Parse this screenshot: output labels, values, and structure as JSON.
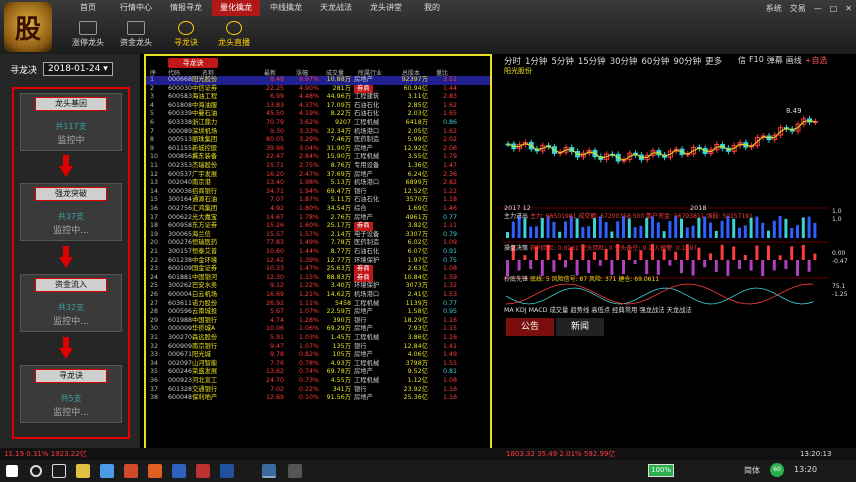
{
  "nav": {
    "tabs": [
      "首页",
      "行情中心",
      "情报寻龙",
      "量化擒龙",
      "中线擒龙",
      "天龙战法",
      "龙头讲堂",
      "我的"
    ],
    "active_index": 3,
    "toolbar": [
      "涨停龙头",
      "资金龙头",
      "寻龙诀",
      "龙头直播"
    ],
    "window": [
      "系统",
      "交易"
    ]
  },
  "logo": {
    "text": "股"
  },
  "left": {
    "title": "寻龙决",
    "date": "2018-01-24",
    "cards": [
      {
        "title": "龙头基因",
        "count": "共117支",
        "monitor": "监控中"
      },
      {
        "title": "强龙突破",
        "count": "共37支",
        "monitor": "监控中..."
      },
      {
        "title": "资金流入",
        "count": "共32支",
        "monitor": "监控中..."
      },
      {
        "title": "寻龙诀",
        "count": "共5支",
        "monitor": "监控中..."
      }
    ]
  },
  "table": {
    "tab": "寻龙诀",
    "headers": [
      "序",
      "代码",
      "名称",
      "最新",
      "涨幅",
      "成交量",
      "所属行业",
      "总股本",
      "量比"
    ],
    "rows": [
      [
        "1",
        "000668",
        "阳光股份",
        "8.49",
        "9.97%",
        "10.88万",
        "房地产",
        "92397万",
        "3.51"
      ],
      [
        "2",
        "600030",
        "中信证券",
        "22.25",
        "4.90%",
        "281万",
        "券商",
        "60.94亿",
        "1.44"
      ],
      [
        "3",
        "600583",
        "海油工程",
        "6.99",
        "4.48%",
        "44.96万",
        "工程建筑",
        "3.11亿",
        "2.83"
      ],
      [
        "4",
        "601808",
        "中海油服",
        "13.83",
        "4.37%",
        "17.09万",
        "石油石化",
        "2.85亿",
        "1.62"
      ],
      [
        "5",
        "600339",
        "中曼石油",
        "45.50",
        "4.19%",
        "8.22万",
        "石油石化",
        "2.03亿",
        "1.65"
      ],
      [
        "6",
        "603338",
        "浙江鼎力",
        "70.79",
        "3.62%",
        "9207",
        "工程机械",
        "6418万",
        "0.86"
      ],
      [
        "7",
        "000089",
        "深圳机场",
        "9.30",
        "3.33%",
        "32.34万",
        "机场港口",
        "2.05亿",
        "1.62"
      ],
      [
        "8",
        "000513",
        "丽珠集团",
        "80.05",
        "3.29%",
        "7.46万",
        "医药制造",
        "5.99亿",
        "2.02"
      ],
      [
        "9",
        "601155",
        "新城控股",
        "39.96",
        "3.04%",
        "31.90万",
        "房地产",
        "12.92亿",
        "2.06"
      ],
      [
        "10",
        "000856",
        "冀东装备",
        "22.47",
        "2.84%",
        "15.90万",
        "工程机械",
        "3.55亿",
        "1.79"
      ],
      [
        "11",
        "002353",
        "杰瑞股份",
        "15.71",
        "2.75%",
        "8.76万",
        "专用设备",
        "1.36亿",
        "1.47"
      ],
      [
        "12",
        "600537",
        "广宇发展",
        "16.20",
        "2.47%",
        "37.69万",
        "房地产",
        "6.24亿",
        "2.36"
      ],
      [
        "13",
        "002040",
        "南京港",
        "13.40",
        "1.98%",
        "5.13万",
        "机场港口",
        "6899万",
        "2.82"
      ],
      [
        "14",
        "000036",
        "招商银行",
        "34.71",
        "1.94%",
        "69.47万",
        "银行",
        "12.52亿",
        "1.22"
      ],
      [
        "15",
        "300164",
        "通源石油",
        "7.07",
        "1.87%",
        "5.11万",
        "石油石化",
        "3570万",
        "1.18"
      ],
      [
        "16",
        "002756",
        "汇鸿集团",
        "4.92",
        "1.80%",
        "34.54万",
        "综合",
        "1.69亿",
        "1.46"
      ],
      [
        "17",
        "000622",
        "光大嘉宝",
        "14.67",
        "1.78%",
        "2.76万",
        "房地产",
        "4961万",
        "0.77"
      ],
      [
        "18",
        "600958",
        "东方证券",
        "15.26",
        "1.60%",
        "25.17万",
        "券商",
        "3.82亿",
        "1.11"
      ],
      [
        "19",
        "300065",
        "海兰信",
        "15.57",
        "1.57%",
        "2.14万",
        "电子设备",
        "3307万",
        "0.79"
      ],
      [
        "20",
        "000276",
        "恒瑞医药",
        "77.83",
        "1.49%",
        "7.78万",
        "医药制造",
        "6.02亿",
        "1.09"
      ],
      [
        "21",
        "300157",
        "恒泰艾普",
        "10.60",
        "1.44%",
        "8.77万",
        "石油石化",
        "6.07亿",
        "0.91"
      ],
      [
        "22",
        "601238",
        "中金环境",
        "12.42",
        "1.39%",
        "12.77万",
        "环境保护",
        "1.97亿",
        "0.75"
      ],
      [
        "23",
        "600109",
        "国金证券",
        "10.33",
        "1.47%",
        "25.63万",
        "券商",
        "2.63亿",
        "1.08"
      ],
      [
        "24",
        "601881",
        "中国银河",
        "12.30",
        "1.15%",
        "88.83万",
        "券商",
        "10.84亿",
        "1.59"
      ],
      [
        "25",
        "300262",
        "巴安水务",
        "9.12",
        "1.22%",
        "3.40万",
        "环境保护",
        "3073万",
        "1.32"
      ],
      [
        "26",
        "600004",
        "白云机场",
        "16.69",
        "1.21%",
        "14.62万",
        "机场港口",
        "2.41亿",
        "1.53"
      ],
      [
        "27",
        "603611",
        "诺力股份",
        "26.92",
        "1.11%",
        "5458",
        "工程机械",
        "1139万",
        "0.77"
      ],
      [
        "28",
        "000596",
        "云南城投",
        "5.67",
        "1.07%",
        "22.59万",
        "房地产",
        "1.58亿",
        "0.95"
      ],
      [
        "29",
        "601988",
        "中国银行",
        "4.74",
        "1.28%",
        "390万",
        "银行",
        "18.29亿",
        "1.16"
      ],
      [
        "30",
        "000009",
        "华侨城A",
        "10.06",
        "1.06%",
        "69.29万",
        "房地产",
        "7.93亿",
        "1.15"
      ],
      [
        "31",
        "300270",
        "森远股份",
        "5.91",
        "1.03%",
        "1.45万",
        "工程机械",
        "3.86亿",
        "1.16"
      ],
      [
        "32",
        "600909",
        "南京银行",
        "9.47",
        "1.07%",
        "135万",
        "银行",
        "12.84亿",
        "1.41"
      ],
      [
        "33",
        "000671",
        "阳光城",
        "9.78",
        "0.82%",
        "105万",
        "房地产",
        "4.06亿",
        "1.49"
      ],
      [
        "34",
        "002097",
        "山河智能",
        "7.76",
        "0.78%",
        "4.93万",
        "工程机械",
        "3798万",
        "1.55"
      ],
      [
        "35",
        "600246",
        "荣盛发展",
        "13.62",
        "0.74%",
        "69.78万",
        "房地产",
        "9.52亿",
        "0.81"
      ],
      [
        "36",
        "000923",
        "河北宣工",
        "24.70",
        "0.73%",
        "4.55万",
        "工程机械",
        "1.12亿",
        "1.08"
      ],
      [
        "37",
        "601328",
        "交通银行",
        "7.02",
        "0.22%",
        "341万",
        "银行",
        "23.92亿",
        "1.16"
      ],
      [
        "38",
        "600048",
        "保利地产",
        "12.69",
        "0.10%",
        "91.56万",
        "房地产",
        "25.36亿",
        "1.16"
      ]
    ]
  },
  "chart": {
    "periods": [
      "分时",
      "1分钟",
      "5分钟",
      "15分钟",
      "30分钟",
      "60分钟",
      "90分钟",
      "更多"
    ],
    "right_tools": [
      "信",
      "F10",
      "弹幕",
      "画线",
      "+自选"
    ],
    "name": "阳光股份",
    "price_label": "8.49",
    "date_left": "2017 12",
    "date_right": "2018",
    "indicator1": "主力进出",
    "ind1_vals": "主力: 66501981  成交额: 67200358.500  散户资金: 56793811  强弱: 50157191",
    "indicator2": "操盘决策",
    "ind2_vals": "获利回吐: 0.0261  空头回吐: 0  空头备空: 0  买入预警: 0.1597",
    "indicator3": "抄底先锋",
    "ind3_vals": "底线: 5  风险信号: 87  风险: 371  建仓: 69.0611",
    "ind_tabs": "MA  KDJ  MACD  成交量  趋势线  高低点  经典常用  强龙战法  天龙战法",
    "tabs": [
      "公告",
      "新闻"
    ],
    "axis": [
      "8.49",
      "1.0",
      "1.0",
      "0.00",
      "-0.47",
      "0.00",
      "75.1",
      "-1.25"
    ]
  },
  "status": {
    "left": "11.19  0.31%  1923.22亿",
    "right": "1803.32  35.49  2.01%  592.99亿",
    "time": "13:20:13"
  },
  "taskbar": {
    "battery": "100%",
    "ime": "简体",
    "badge": "60",
    "clock": "13:20"
  },
  "colors": {
    "up": "#ff3b3b",
    "down": "#39d5d5",
    "accent": "#c01818",
    "highlight": "#e8e020"
  }
}
